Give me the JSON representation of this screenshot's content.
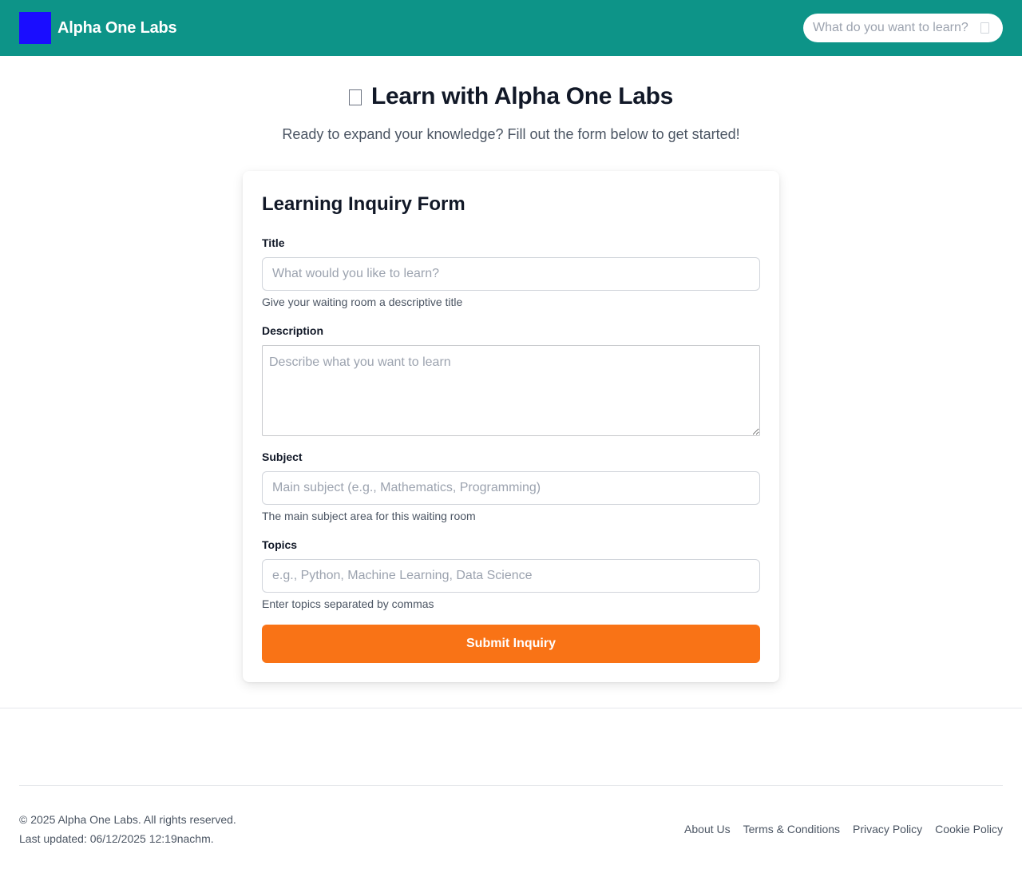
{
  "header": {
    "brand": "Alpha One Labs",
    "search_placeholder": "What do you want to learn?",
    "logo_icon": "logo-square",
    "search_icon": "search-icon"
  },
  "hero": {
    "title": "Learn with Alpha One Labs",
    "subtitle": "Ready to expand your knowledge? Fill out the form below to get started!"
  },
  "form": {
    "title": "Learning Inquiry Form",
    "fields": {
      "title": {
        "label": "Title",
        "placeholder": "What would you like to learn?",
        "help": "Give your waiting room a descriptive title"
      },
      "description": {
        "label": "Description",
        "placeholder": "Describe what you want to learn"
      },
      "subject": {
        "label": "Subject",
        "placeholder": "Main subject (e.g., Mathematics, Programming)",
        "help": "The main subject area for this waiting room"
      },
      "topics": {
        "label": "Topics",
        "placeholder": "e.g., Python, Machine Learning, Data Science",
        "help": "Enter topics separated by commas"
      }
    },
    "submit_label": "Submit Inquiry"
  },
  "footer": {
    "copyright": "© 2025 Alpha One Labs. All rights reserved.",
    "last_updated": "Last updated: 06/12/2025 12:19nachm.",
    "links": [
      "About Us",
      "Terms & Conditions",
      "Privacy Policy",
      "Cookie Policy"
    ]
  },
  "colors": {
    "header_bg": "#0d9488",
    "logo": "#1a0dff",
    "accent_button": "#f97316"
  }
}
